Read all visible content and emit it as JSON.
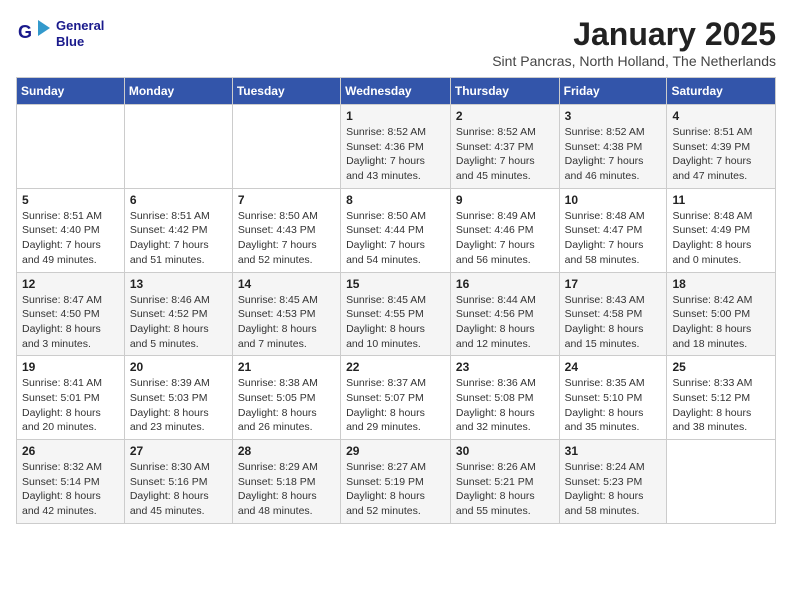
{
  "logo": {
    "line1": "General",
    "line2": "Blue"
  },
  "title": "January 2025",
  "subtitle": "Sint Pancras, North Holland, The Netherlands",
  "weekdays": [
    "Sunday",
    "Monday",
    "Tuesday",
    "Wednesday",
    "Thursday",
    "Friday",
    "Saturday"
  ],
  "weeks": [
    [
      {
        "day": "",
        "info": ""
      },
      {
        "day": "",
        "info": ""
      },
      {
        "day": "",
        "info": ""
      },
      {
        "day": "1",
        "info": "Sunrise: 8:52 AM\nSunset: 4:36 PM\nDaylight: 7 hours\nand 43 minutes."
      },
      {
        "day": "2",
        "info": "Sunrise: 8:52 AM\nSunset: 4:37 PM\nDaylight: 7 hours\nand 45 minutes."
      },
      {
        "day": "3",
        "info": "Sunrise: 8:52 AM\nSunset: 4:38 PM\nDaylight: 7 hours\nand 46 minutes."
      },
      {
        "day": "4",
        "info": "Sunrise: 8:51 AM\nSunset: 4:39 PM\nDaylight: 7 hours\nand 47 minutes."
      }
    ],
    [
      {
        "day": "5",
        "info": "Sunrise: 8:51 AM\nSunset: 4:40 PM\nDaylight: 7 hours\nand 49 minutes."
      },
      {
        "day": "6",
        "info": "Sunrise: 8:51 AM\nSunset: 4:42 PM\nDaylight: 7 hours\nand 51 minutes."
      },
      {
        "day": "7",
        "info": "Sunrise: 8:50 AM\nSunset: 4:43 PM\nDaylight: 7 hours\nand 52 minutes."
      },
      {
        "day": "8",
        "info": "Sunrise: 8:50 AM\nSunset: 4:44 PM\nDaylight: 7 hours\nand 54 minutes."
      },
      {
        "day": "9",
        "info": "Sunrise: 8:49 AM\nSunset: 4:46 PM\nDaylight: 7 hours\nand 56 minutes."
      },
      {
        "day": "10",
        "info": "Sunrise: 8:48 AM\nSunset: 4:47 PM\nDaylight: 7 hours\nand 58 minutes."
      },
      {
        "day": "11",
        "info": "Sunrise: 8:48 AM\nSunset: 4:49 PM\nDaylight: 8 hours\nand 0 minutes."
      }
    ],
    [
      {
        "day": "12",
        "info": "Sunrise: 8:47 AM\nSunset: 4:50 PM\nDaylight: 8 hours\nand 3 minutes."
      },
      {
        "day": "13",
        "info": "Sunrise: 8:46 AM\nSunset: 4:52 PM\nDaylight: 8 hours\nand 5 minutes."
      },
      {
        "day": "14",
        "info": "Sunrise: 8:45 AM\nSunset: 4:53 PM\nDaylight: 8 hours\nand 7 minutes."
      },
      {
        "day": "15",
        "info": "Sunrise: 8:45 AM\nSunset: 4:55 PM\nDaylight: 8 hours\nand 10 minutes."
      },
      {
        "day": "16",
        "info": "Sunrise: 8:44 AM\nSunset: 4:56 PM\nDaylight: 8 hours\nand 12 minutes."
      },
      {
        "day": "17",
        "info": "Sunrise: 8:43 AM\nSunset: 4:58 PM\nDaylight: 8 hours\nand 15 minutes."
      },
      {
        "day": "18",
        "info": "Sunrise: 8:42 AM\nSunset: 5:00 PM\nDaylight: 8 hours\nand 18 minutes."
      }
    ],
    [
      {
        "day": "19",
        "info": "Sunrise: 8:41 AM\nSunset: 5:01 PM\nDaylight: 8 hours\nand 20 minutes."
      },
      {
        "day": "20",
        "info": "Sunrise: 8:39 AM\nSunset: 5:03 PM\nDaylight: 8 hours\nand 23 minutes."
      },
      {
        "day": "21",
        "info": "Sunrise: 8:38 AM\nSunset: 5:05 PM\nDaylight: 8 hours\nand 26 minutes."
      },
      {
        "day": "22",
        "info": "Sunrise: 8:37 AM\nSunset: 5:07 PM\nDaylight: 8 hours\nand 29 minutes."
      },
      {
        "day": "23",
        "info": "Sunrise: 8:36 AM\nSunset: 5:08 PM\nDaylight: 8 hours\nand 32 minutes."
      },
      {
        "day": "24",
        "info": "Sunrise: 8:35 AM\nSunset: 5:10 PM\nDaylight: 8 hours\nand 35 minutes."
      },
      {
        "day": "25",
        "info": "Sunrise: 8:33 AM\nSunset: 5:12 PM\nDaylight: 8 hours\nand 38 minutes."
      }
    ],
    [
      {
        "day": "26",
        "info": "Sunrise: 8:32 AM\nSunset: 5:14 PM\nDaylight: 8 hours\nand 42 minutes."
      },
      {
        "day": "27",
        "info": "Sunrise: 8:30 AM\nSunset: 5:16 PM\nDaylight: 8 hours\nand 45 minutes."
      },
      {
        "day": "28",
        "info": "Sunrise: 8:29 AM\nSunset: 5:18 PM\nDaylight: 8 hours\nand 48 minutes."
      },
      {
        "day": "29",
        "info": "Sunrise: 8:27 AM\nSunset: 5:19 PM\nDaylight: 8 hours\nand 52 minutes."
      },
      {
        "day": "30",
        "info": "Sunrise: 8:26 AM\nSunset: 5:21 PM\nDaylight: 8 hours\nand 55 minutes."
      },
      {
        "day": "31",
        "info": "Sunrise: 8:24 AM\nSunset: 5:23 PM\nDaylight: 8 hours\nand 58 minutes."
      },
      {
        "day": "",
        "info": ""
      }
    ]
  ]
}
